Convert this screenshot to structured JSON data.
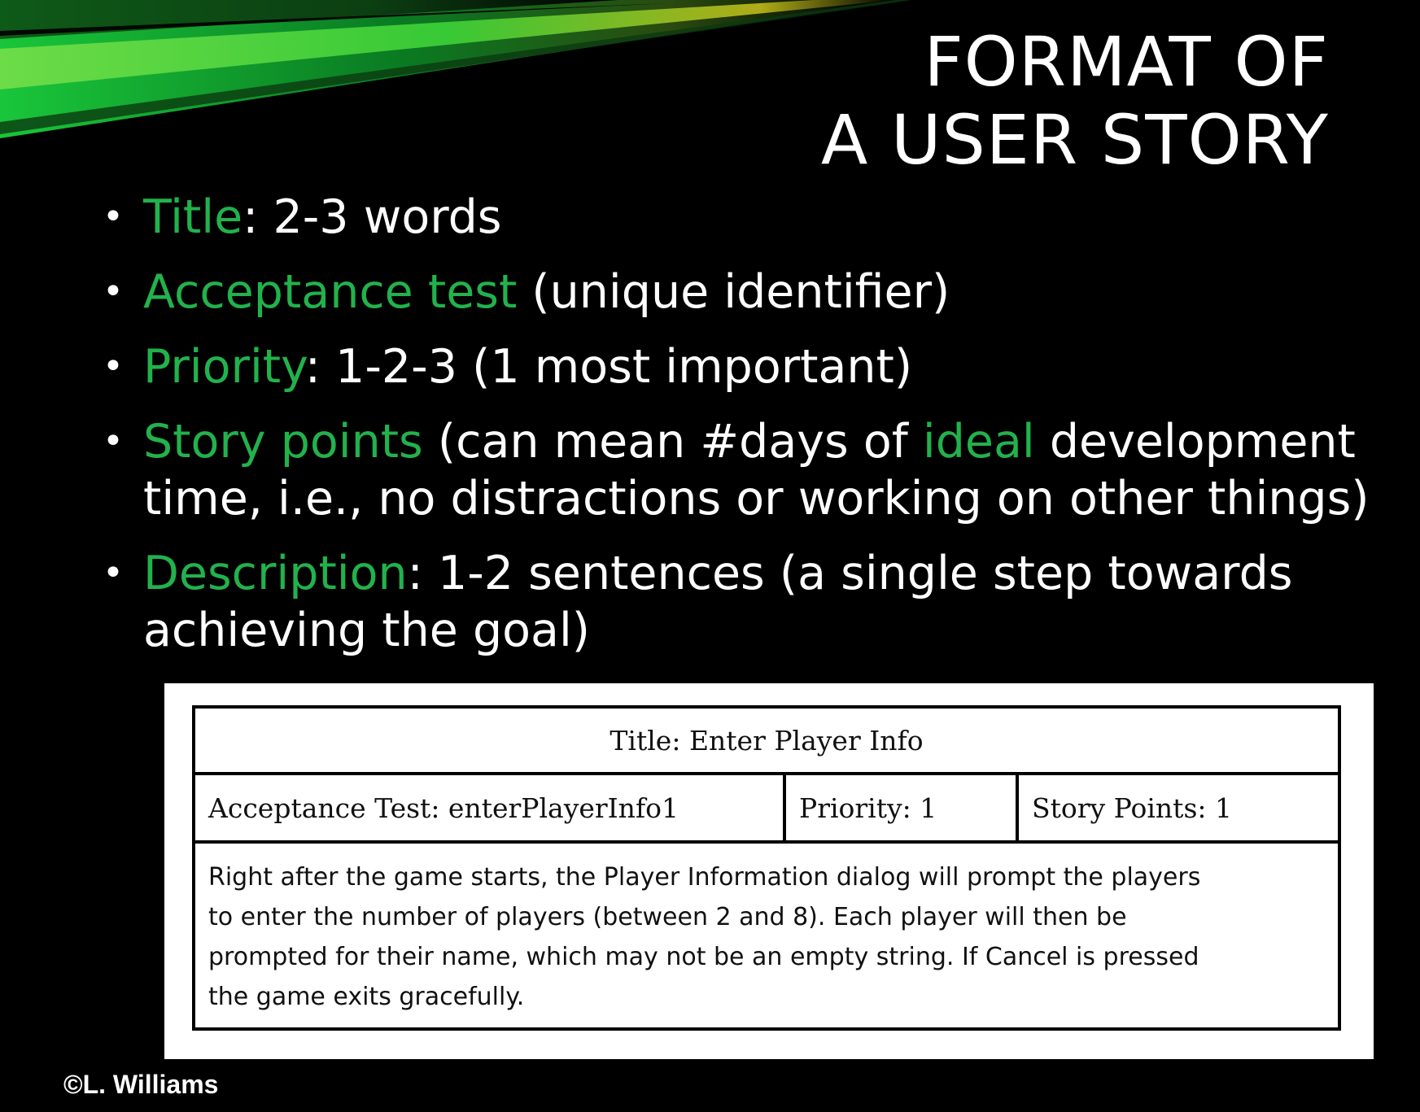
{
  "slide": {
    "title_lines": [
      "FORMAT OF",
      "A USER STORY"
    ],
    "accent_color": "#22b24c",
    "bullets": [
      {
        "term": "Title",
        "rest": ": 2-3 words"
      },
      {
        "term": "Acceptance test",
        "rest": " (unique identifier)"
      },
      {
        "term": "Priority",
        "rest": ": 1-2-3 (1 most important)"
      },
      {
        "term": "Story points",
        "rest_a": " (can mean #days of ",
        "term_b": "ideal",
        "rest_b": " development time, i.e., no distractions or working on other things)"
      },
      {
        "term": "Description",
        "rest": ": 1-2 sentences (a single step towards achieving the goal)"
      }
    ],
    "bullet_glyph": "•",
    "credit": "©L. Williams"
  },
  "story_card": {
    "title": "Title: Enter Player Info",
    "acceptance_test": "Acceptance Test: enterPlayerInfo1",
    "priority": "Priority: 1",
    "story_points": "Story Points: 1",
    "description": "Right after the game starts, the Player Information dialog will prompt the players\nto enter the number of players (between 2 and 8).  Each player will then be\nprompted for their name, which may not be an empty string.  If Cancel is pressed\nthe game exits gracefully."
  }
}
